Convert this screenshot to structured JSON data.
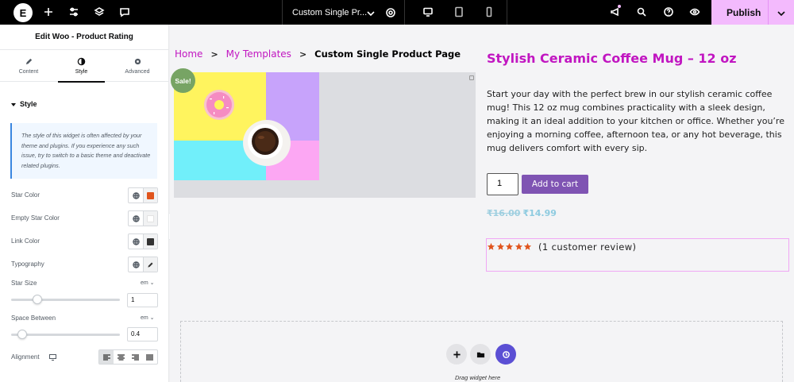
{
  "topbar": {
    "document_title": "Custom Single Pr...",
    "publish_label": "Publish",
    "colors": {
      "bg": "#000000",
      "publish_bg": "#f3bafd"
    },
    "icons": [
      "elementor-logo-icon",
      "plus-icon",
      "sliders-icon",
      "layers-icon",
      "comment-icon",
      "chevron-down-icon",
      "gear-icon",
      "desktop-icon",
      "tablet-icon",
      "mobile-icon",
      "megaphone-icon",
      "search-icon",
      "help-icon",
      "eye-icon"
    ]
  },
  "panel": {
    "title": "Edit Woo - Product Rating",
    "tabs": [
      {
        "label": "Content",
        "icon": "pencil-icon"
      },
      {
        "label": "Style",
        "icon": "half-circle-icon"
      },
      {
        "label": "Advanced",
        "icon": "gear-icon"
      }
    ],
    "active_tab": "Style",
    "section_title": "Style",
    "notice": "The style of this widget is often affected by your theme and plugins. If you experience any such issue, try to switch to a basic theme and deactivate related plugins.",
    "controls": {
      "star_color": {
        "label": "Star Color",
        "value": "#e0541c"
      },
      "empty_star_color": {
        "label": "Empty Star Color",
        "value": "#ececec"
      },
      "link_color": {
        "label": "Link Color",
        "value": "#333333"
      },
      "typography": {
        "label": "Typography"
      },
      "star_size": {
        "label": "Star Size",
        "unit": "em",
        "value": "1",
        "slider_fraction": 0.24
      },
      "space_between": {
        "label": "Space Between",
        "unit": "em",
        "value": "0.4",
        "slider_fraction": 0.1
      },
      "alignment": {
        "label": "Alignment",
        "options": [
          "left",
          "center",
          "right",
          "justify"
        ],
        "selected": "left"
      }
    }
  },
  "canvas": {
    "breadcrumb": {
      "home": "Home",
      "templates": "My Templates",
      "current": "Custom Single Product Page",
      "separator": ">"
    },
    "sale_badge": "Sale!",
    "product_title": "Stylish Ceramic Coffee Mug – 12 oz",
    "description": "Start your day with the perfect brew in our stylish ceramic coffee mug! This 12 oz mug combines practicality with a sleek design, making it an ideal addition to your kitchen or office. Whether you’re enjoying a morning coffee, afternoon tea, or any hot beverage, this mug delivers comfort with every sip.",
    "quantity": "1",
    "add_to_cart": "Add to cart",
    "price_old": "₹16.00",
    "price_new": "₹14.99",
    "rating": {
      "value": 5,
      "max": 5,
      "review_text": "(1 customer review)"
    },
    "dropzone_text": "Drag widget here",
    "colors": {
      "accent": "#c116c1",
      "button": "#7f54b3",
      "sale": "#77a464",
      "star": "#e0541c"
    }
  }
}
